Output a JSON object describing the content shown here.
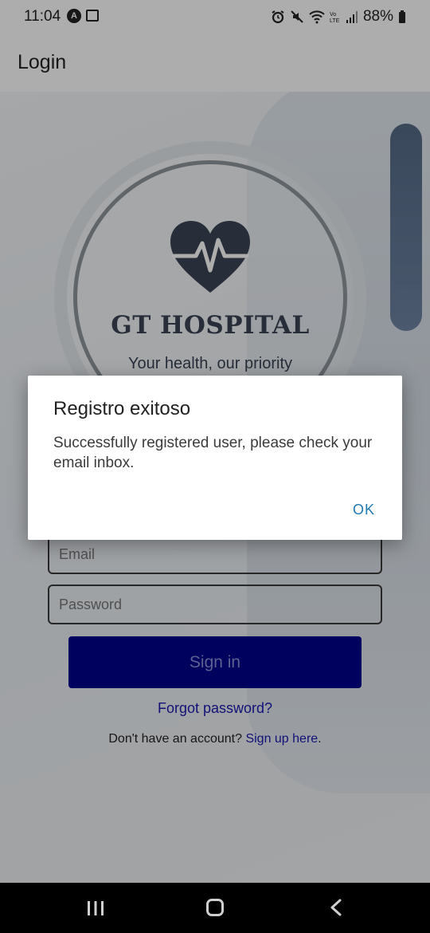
{
  "status_bar": {
    "time": "11:04",
    "battery": "88%",
    "icons": [
      "nfc-a-icon",
      "gallery-icon",
      "alarm-icon",
      "mute-icon",
      "wifi-icon",
      "volte-icon",
      "signal-icon",
      "battery-icon"
    ]
  },
  "app_bar": {
    "title": "Login"
  },
  "brand": {
    "name": "GT HOSPITAL",
    "tagline": "Your health, our priority",
    "logo_icon": "heart-pulse-icon"
  },
  "form": {
    "email_placeholder": "Email",
    "password_placeholder": "Password",
    "signin_label": "Sign in",
    "forgot_label": "Forgot password?",
    "signup_prompt": "Don't have an account?",
    "signup_link": "Sign up here",
    "signup_suffix": "."
  },
  "dialog": {
    "title": "Registro exitoso",
    "message": "Successfully registered user, please check your email inbox.",
    "ok_label": "OK"
  },
  "nav_bar": {
    "icons": [
      "recents-icon",
      "home-icon",
      "back-icon"
    ]
  },
  "colors": {
    "primary_button": "#00008b",
    "link": "#1a1ab0",
    "dialog_action": "#1f7ab3",
    "brand_text": "#3a4555"
  }
}
